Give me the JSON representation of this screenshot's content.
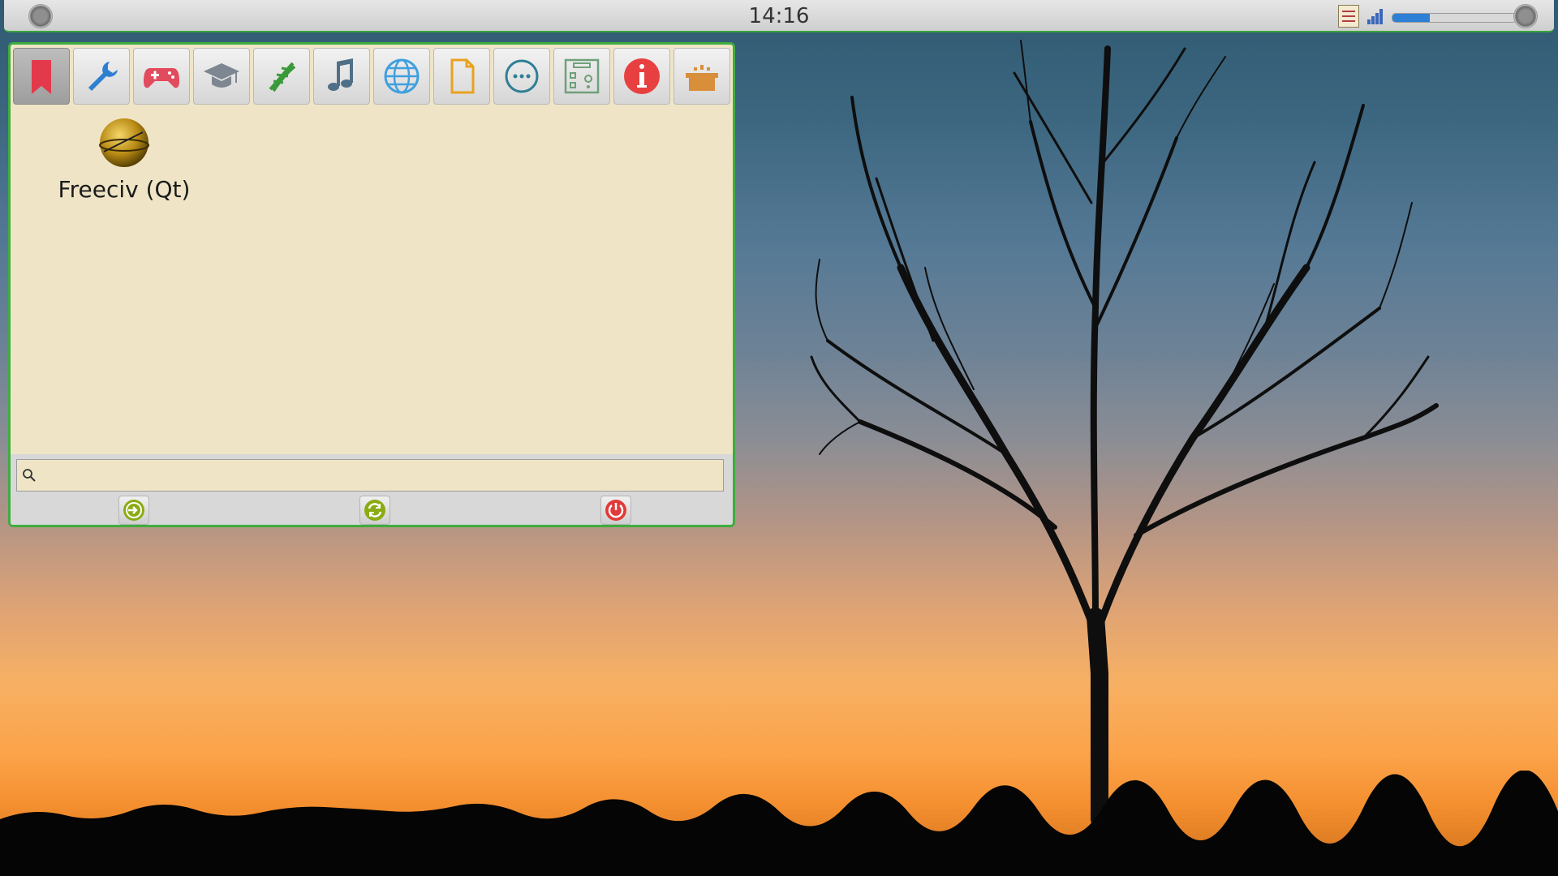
{
  "topbar": {
    "clock": "14:16",
    "volume_level": 0.3
  },
  "launcher": {
    "categories": [
      {
        "name": "favorites",
        "icon": "bookmark-icon",
        "active": true
      },
      {
        "name": "system",
        "icon": "wrench-icon",
        "active": false
      },
      {
        "name": "games",
        "icon": "gamepad-icon",
        "active": false
      },
      {
        "name": "education",
        "icon": "graduation-cap-icon",
        "active": false
      },
      {
        "name": "science",
        "icon": "dna-icon",
        "active": false
      },
      {
        "name": "multimedia",
        "icon": "music-note-icon",
        "active": false
      },
      {
        "name": "internet",
        "icon": "globe-icon",
        "active": false
      },
      {
        "name": "office",
        "icon": "document-icon",
        "active": false
      },
      {
        "name": "other",
        "icon": "more-icon",
        "active": false
      },
      {
        "name": "settings",
        "icon": "control-panel-icon",
        "active": false
      },
      {
        "name": "information",
        "icon": "info-icon",
        "active": false
      },
      {
        "name": "install",
        "icon": "open-box-icon",
        "active": false
      }
    ],
    "apps": [
      {
        "label": "Freeciv (Qt)",
        "icon": "freeciv-globe-icon"
      }
    ],
    "search": {
      "value": "",
      "placeholder": ""
    },
    "footer": [
      {
        "name": "logout",
        "icon": "logout-icon"
      },
      {
        "name": "restart",
        "icon": "restart-icon"
      },
      {
        "name": "shutdown",
        "icon": "power-icon"
      }
    ]
  },
  "colors": {
    "accent_green": "#3fad3f",
    "panel_bg": "#efe5c6",
    "power_red": "#e23a3a",
    "action_green": "#8aab13"
  }
}
